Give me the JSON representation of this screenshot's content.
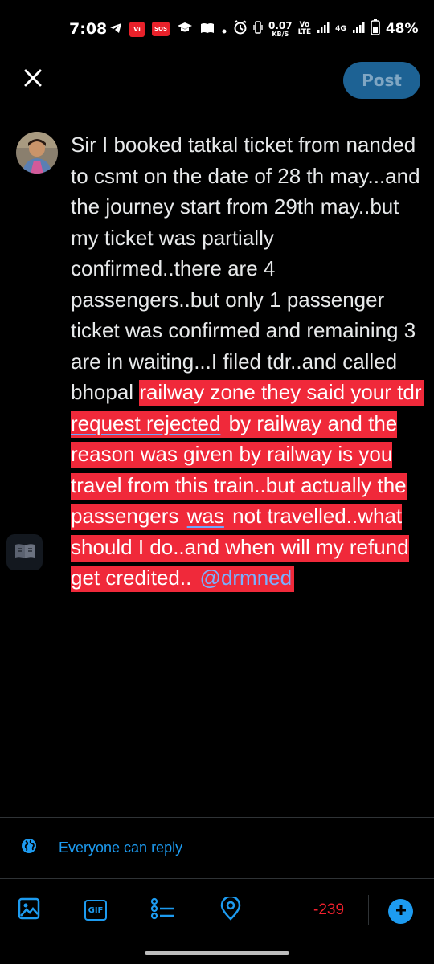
{
  "status_bar": {
    "time": "7:08",
    "vi_label": "Vi",
    "sos_label": "SOS",
    "net_speed_value": "0.07",
    "net_speed_unit": "KB/S",
    "volte_top": "Vo",
    "volte_bottom": "LTE",
    "network_type": "4G",
    "battery": "48%"
  },
  "top_bar": {
    "post_label": "Post",
    "close_icon": "close-icon"
  },
  "compose": {
    "text_plain": "Sir I booked tatkal ticket from nanded to csmt on the date of 28 th may...and the journey start from 29th may..but my ticket was partially confirmed..there are 4 passengers..but only 1 passenger ticket was confirmed and remaining 3 are in waiting...I filed tdr..and called bhopal ",
    "hl_1": "railway zone they said your tdr ",
    "hl_2": "request rejected",
    "hl_3": " by railway and the reason was given by railway is you travel from this train..but actually the passengers ",
    "hl_4": "was",
    "hl_5": " not travelled..what should I do..and when will my refund get credited.. ",
    "mention": "@drmned"
  },
  "reply_setting": {
    "label": "Everyone can reply",
    "icon": "globe-icon"
  },
  "toolbar": {
    "icons": [
      "image-icon",
      "gif-icon",
      "poll-icon",
      "location-icon"
    ],
    "gif_label": "GIF",
    "char_count": "-239",
    "add_icon": "plus-icon"
  },
  "colors": {
    "accent": "#1d9bf0",
    "post_button": "#1d6294",
    "highlight": "#f0293a",
    "over_limit": "#f4212e"
  }
}
